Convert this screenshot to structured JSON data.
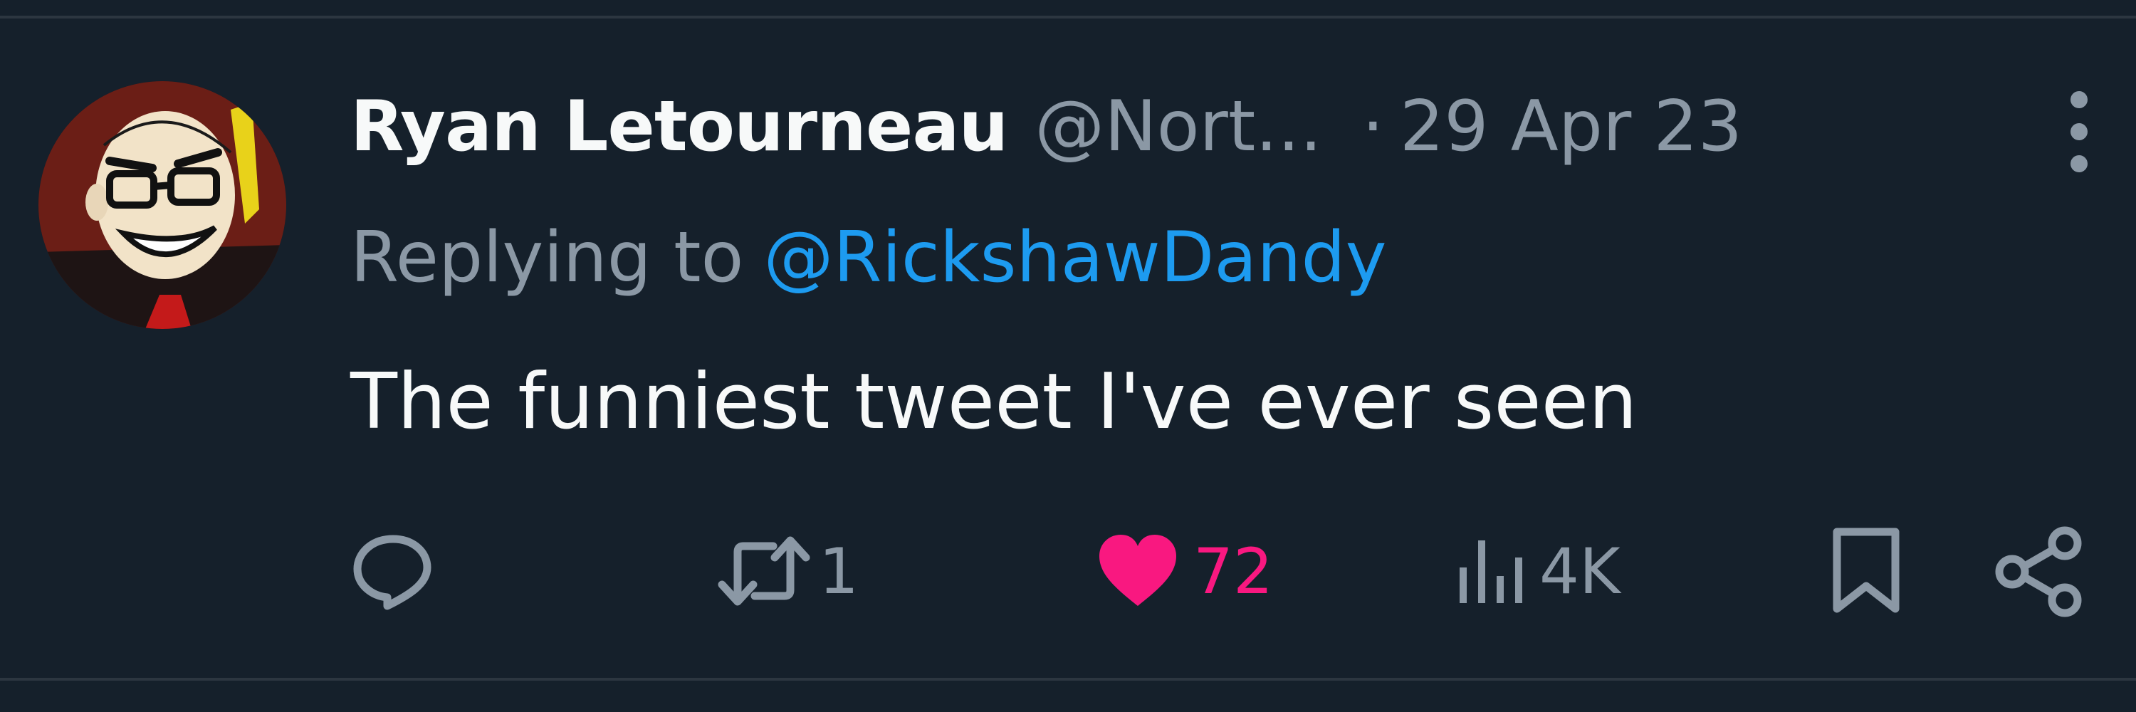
{
  "author": {
    "display_name": "Ryan Letourneau",
    "handle": "@Nort...",
    "separator": "·",
    "date": "29 Apr 23",
    "avatar_icon": "cartoon-avatar-icon"
  },
  "reply_context": {
    "label": "Replying to",
    "handle": "@RickshawDandy"
  },
  "tweet": {
    "text": "The funniest tweet I've ever seen"
  },
  "actions": {
    "reply": {
      "icon": "reply-icon",
      "count": ""
    },
    "retweet": {
      "icon": "retweet-icon",
      "count": "1"
    },
    "like": {
      "icon": "heart-icon",
      "count": "72",
      "liked": true
    },
    "views": {
      "icon": "views-icon",
      "count": "4K"
    },
    "bookmark": {
      "icon": "bookmark-icon"
    },
    "share": {
      "icon": "share-icon"
    }
  },
  "colors": {
    "background": "#15202b",
    "primary_text": "#f7f9f9",
    "secondary_text": "#8b98a5",
    "link": "#1d9bf0",
    "like": "#f91880",
    "divider": "#2c3640"
  }
}
